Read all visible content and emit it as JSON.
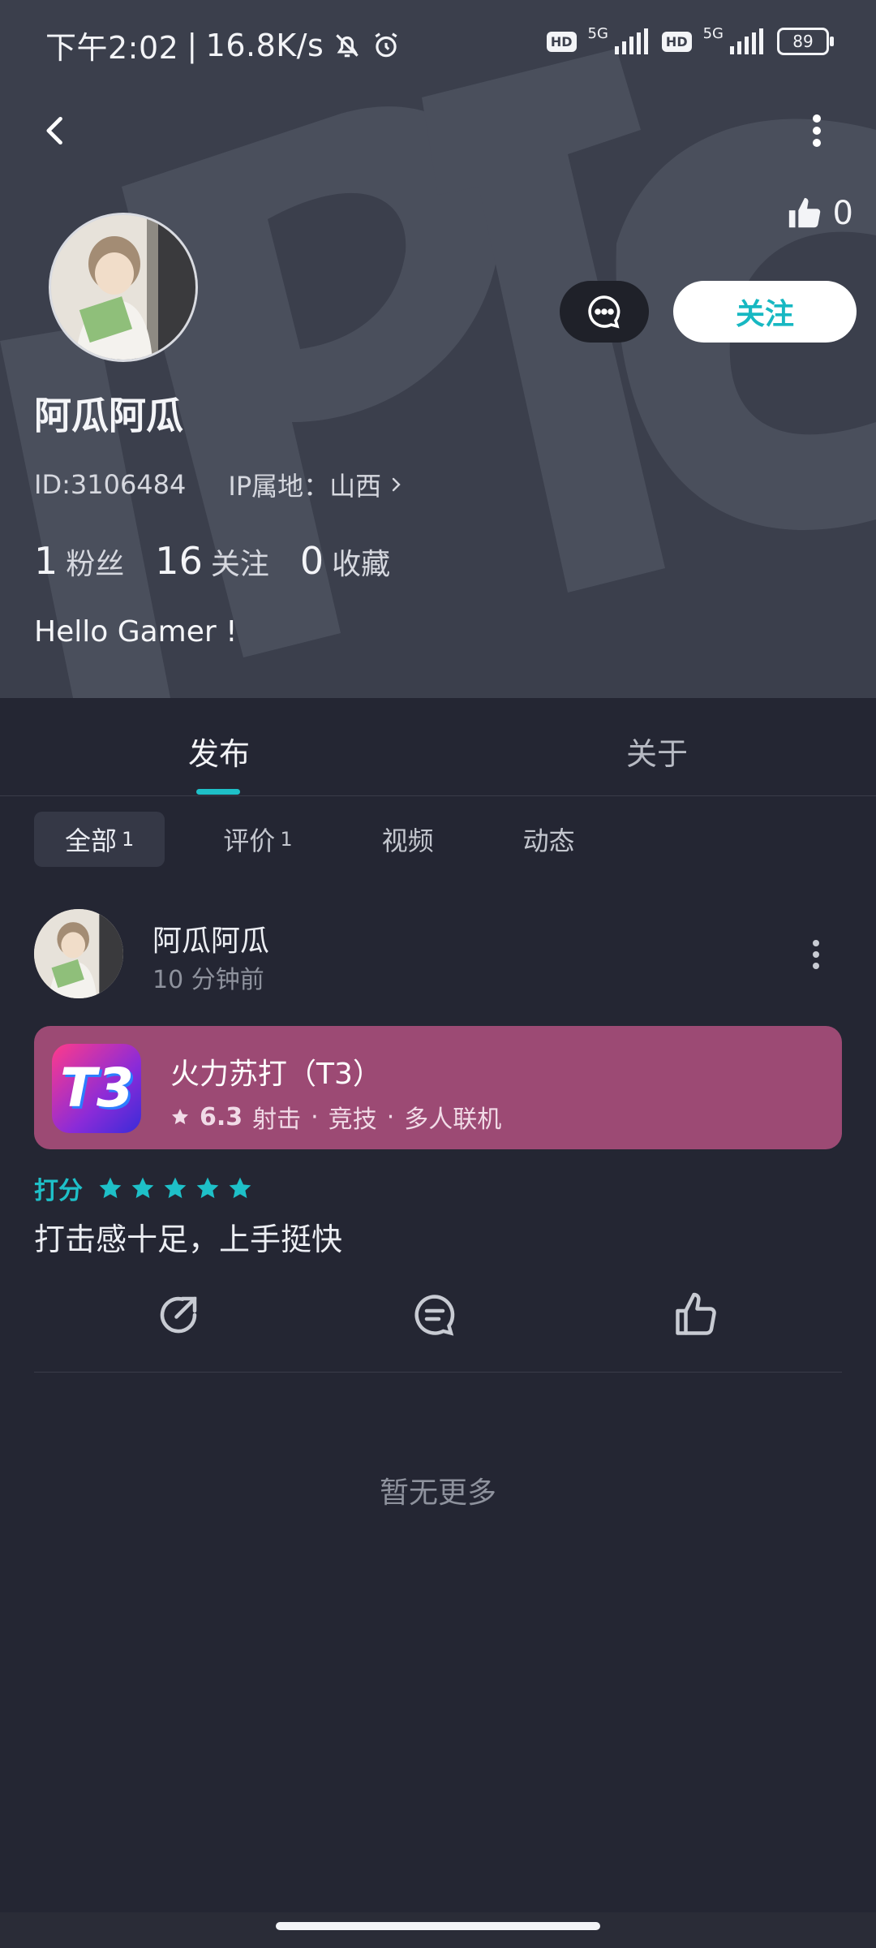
{
  "status_bar": {
    "time": "下午2:02",
    "speed": "16.8K/s",
    "hd1": "HD",
    "net1": "5G",
    "hd2": "HD",
    "net2": "5G",
    "battery": "89"
  },
  "profile": {
    "likes": "0",
    "follow_label": "关注",
    "name": "阿瓜阿瓜",
    "id_text": "ID:3106484",
    "ip_text": "IP属地：山西",
    "stats": [
      {
        "num": "1",
        "label": "粉丝"
      },
      {
        "num": "16",
        "label": "关注"
      },
      {
        "num": "0",
        "label": "收藏"
      }
    ],
    "bio": "Hello Gamer !"
  },
  "tabs": {
    "publish": "发布",
    "about": "关于"
  },
  "filters": {
    "all": "全部",
    "all_count": "1",
    "review": "评价",
    "review_count": "1",
    "video": "视频",
    "moments": "动态"
  },
  "post": {
    "author": "阿瓜阿瓜",
    "time": "10 分钟前",
    "game_title": "火力苏打（T3）",
    "game_icon_text": "T3",
    "game_rating": "6.3",
    "game_tags": [
      "射击",
      "竞技",
      "多人联机"
    ],
    "score_label": "打分",
    "stars": 5,
    "review": "打击感十足，上手挺快"
  },
  "footer": {
    "no_more": "暂无更多"
  },
  "colors": {
    "accent": "#1ec0c8",
    "header_bg": "#3b3f4c",
    "page_bg": "#242633",
    "game_card": "#9c4a74"
  }
}
